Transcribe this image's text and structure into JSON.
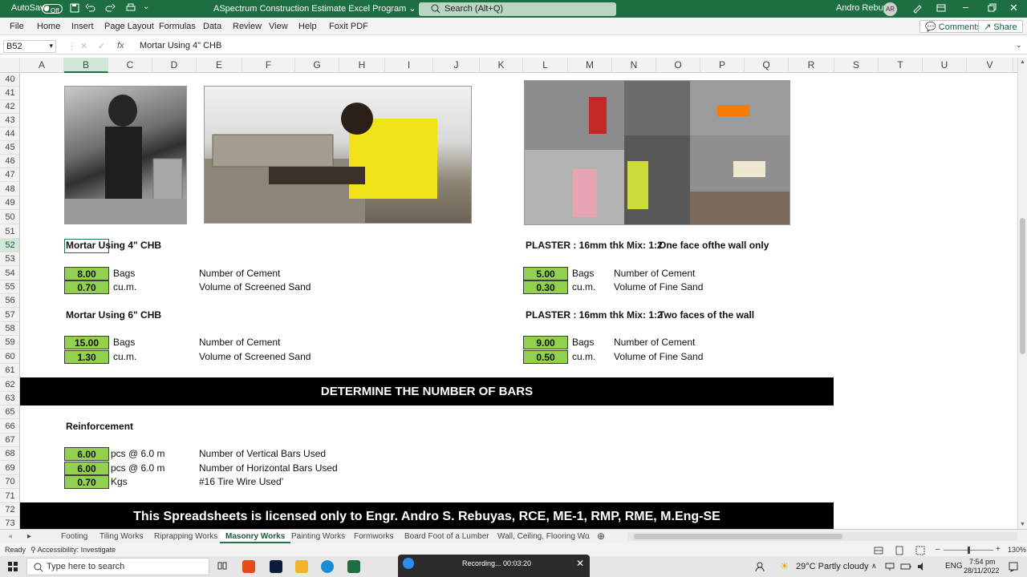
{
  "titlebar": {
    "autosave_label": "AutoSave",
    "autosave_state": "Off",
    "doc_title": "ASpectrum Construction Estimate Excel Program",
    "search_placeholder": "Search (Alt+Q)",
    "user_name": "Andro Rebuyas",
    "user_initials": "AR",
    "title_bg": "#1d6f42"
  },
  "ribbon": {
    "tabs": [
      "File",
      "Home",
      "Insert",
      "Page Layout",
      "Formulas",
      "Data",
      "Review",
      "View",
      "Help",
      "Foxit PDF"
    ],
    "comments_label": "Comments",
    "share_label": "Share"
  },
  "formula_bar": {
    "name_box": "B52",
    "fx": "fx",
    "content": "Mortar Using 4\" CHB"
  },
  "columns": [
    "A",
    "B",
    "C",
    "D",
    "E",
    "F",
    "G",
    "H",
    "I",
    "J",
    "K",
    "L",
    "M",
    "N",
    "O",
    "P",
    "Q",
    "R",
    "S",
    "T",
    "U",
    "V"
  ],
  "selected_column": "B",
  "rows": [
    "40",
    "41",
    "42",
    "43",
    "44",
    "45",
    "46",
    "47",
    "48",
    "49",
    "50",
    "51",
    "52",
    "53",
    "54",
    "55",
    "56",
    "57",
    "58",
    "59",
    "60",
    "61",
    "62",
    "63",
    "65",
    "66",
    "67",
    "68",
    "69",
    "70",
    "71",
    "72",
    "73"
  ],
  "selected_row": "52",
  "sheet": {
    "mortar4": {
      "title": "Mortar Using 4\" CHB",
      "cement_value": "8.00",
      "cement_unit": "Bags",
      "cement_desc": "Number of Cement",
      "sand_value": "0.70",
      "sand_unit": "cu.m.",
      "sand_desc": "Volume of Screened Sand"
    },
    "mortar6": {
      "title": "Mortar Using 6\" CHB",
      "cement_value": "15.00",
      "cement_unit": "Bags",
      "cement_desc": "Number of Cement",
      "sand_value": "1.30",
      "sand_unit": "cu.m.",
      "sand_desc": "Volume of Screened Sand"
    },
    "plaster1": {
      "title": "PLASTER : 16mm thk Mix: 1:2",
      "note": "One face ofthe wall only",
      "cement_value": "5.00",
      "cement_unit": "Bags",
      "cement_desc": "Number of Cement",
      "sand_value": "0.30",
      "sand_unit": "cu.m.",
      "sand_desc": "Volume of Fine Sand"
    },
    "plaster2": {
      "title": "PLASTER : 16mm thk Mix: 1:2",
      "note": "Two faces of the wall",
      "cement_value": "9.00",
      "cement_unit": "Bags",
      "cement_desc": "Number of Cement",
      "sand_value": "0.50",
      "sand_unit": "cu.m.",
      "sand_desc": "Volume of Fine Sand"
    },
    "bars_banner": "DETERMINE THE NUMBER OF BARS",
    "reinforcement": {
      "title": "Reinforcement",
      "vert_value": "6.00",
      "vert_unit": "pcs @ 6.0 m",
      "vert_desc": "Number of Vertical Bars Used",
      "horiz_value": "6.00",
      "horiz_unit": "pcs @ 6.0 m",
      "horiz_desc": "Number of Horizontal Bars Used",
      "wire_value": "0.70",
      "wire_unit": "Kgs",
      "wire_desc": "#16 Tire Wire Used'"
    },
    "license_banner": "This Spreadsheets is licensed only to Engr. Andro S. Rebuyas, RCE, ME-1, RMP, RME, M.Eng-SE",
    "green": "#92d050"
  },
  "sheet_tabs": [
    "Footing",
    "Tiling Works",
    "Riprapping Works",
    "Masonry Works",
    "Painting Works",
    "Formworks",
    "Board Foot of a Lumber",
    "Wall, Ceiling, Flooring Wo"
  ],
  "active_tab": "Masonry Works",
  "status": {
    "ready": "Ready",
    "accessibility": "Accessibility: Investigate",
    "zoom": "130%"
  },
  "recording": {
    "label": "Recording... 00:03:20"
  },
  "taskbar": {
    "search_placeholder": "Type here to search",
    "weather": "29°C  Partly cloudy",
    "lang": "ENG",
    "time": "7:54 pm",
    "date": "28/11/2022"
  }
}
